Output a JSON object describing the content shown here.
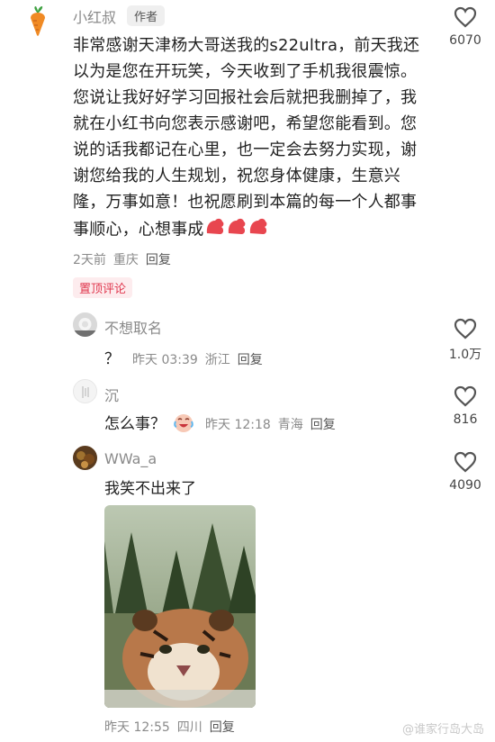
{
  "main_comment": {
    "author": "小红叔",
    "badge": "作者",
    "text": "非常感谢天津杨大哥送我的s22ultra，前天我还以为是您在开玩笑，今天收到了手机我很震惊。您说让我好好学习回报社会后就把我删掉了，我就在小红书向您表示感谢吧，希望您能看到。您说的话我都记在心里，也一定会去努力实现，谢谢您给我的人生规划，祝您身体健康，生意兴隆，万事如意！也祝愿刷到本篇的每一个人都事事顺心，心想事成",
    "time": "2天前",
    "location": "重庆",
    "reply": "回复",
    "pinned": "置顶评论",
    "likes": "6070"
  },
  "replies": [
    {
      "author": "不想取名",
      "text": "？",
      "time": "昨天 03:39",
      "location": "浙江",
      "reply": "回复",
      "likes": "1.0万"
    },
    {
      "author": "沉",
      "text": "怎么事？",
      "time": "昨天 12:18",
      "location": "青海",
      "reply": "回复",
      "likes": "816"
    },
    {
      "author": "WWa_a",
      "text": "我笑不出来了",
      "time": "昨天 12:55",
      "location": "四川",
      "reply": "回复",
      "likes": "4090"
    }
  ],
  "watermark": "@谁家行岛大岛",
  "icons": {
    "like": "heart-outline-icon",
    "emoji_muscle": "flexed-biceps-emoji",
    "emoji_laugh": "laughing-crying-emoji",
    "carrot_avatar": "carrot-icon"
  },
  "colors": {
    "pinned_text": "#e0374e",
    "pinned_bg": "#fdecee",
    "meta": "#8a8a8a"
  }
}
